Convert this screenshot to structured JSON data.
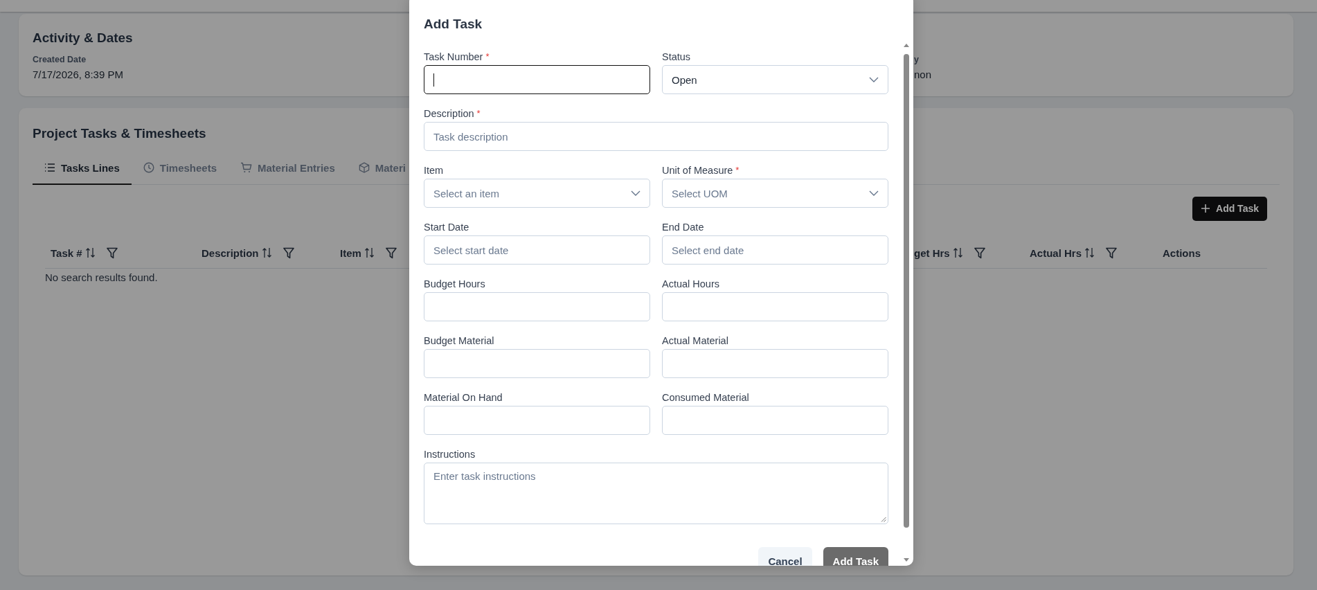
{
  "activity": {
    "title": "Activity & Dates",
    "fields": [
      {
        "label": "Created Date",
        "value": "7/17/2026, 8:39 PM"
      },
      {
        "label": "y",
        "value": "non"
      }
    ]
  },
  "tasks_panel": {
    "title": "Project Tasks & Timesheets",
    "tabs": [
      {
        "label": "Tasks Lines",
        "selected": true
      },
      {
        "label": "Timesheets",
        "selected": false
      },
      {
        "label": "Material Entries",
        "selected": false
      },
      {
        "label": "Materi",
        "selected": false
      }
    ],
    "add_button": "Add Task",
    "columns": [
      {
        "label": "Task #",
        "sortable": true,
        "filterable": true
      },
      {
        "label": "Description",
        "sortable": true,
        "filterable": true
      },
      {
        "label": "Item",
        "sortable": true,
        "filterable": true
      },
      {
        "label": "get Hrs",
        "sortable": true,
        "filterable": true
      },
      {
        "label": "Actual Hrs",
        "sortable": true,
        "filterable": true
      },
      {
        "label": "Actions",
        "sortable": false,
        "filterable": false
      }
    ],
    "empty_message": "No search results found."
  },
  "dialog": {
    "title": "Add Task",
    "fields": [
      {
        "label": "Task Number",
        "required_mark": "*",
        "kind": "text",
        "focused": true
      },
      {
        "label": "Status",
        "kind": "select",
        "value": "Open"
      },
      {
        "label": "Description",
        "required_mark": "*",
        "kind": "text",
        "placeholder": "Task description",
        "full_width": true
      },
      {
        "label": "Item",
        "kind": "select",
        "placeholder": "Select an item"
      },
      {
        "label": "Unit of Measure",
        "required_mark": "*",
        "kind": "select",
        "placeholder": "Select UOM"
      },
      {
        "label": "Start Date",
        "kind": "text",
        "placeholder": "Select start date"
      },
      {
        "label": "End Date",
        "kind": "text",
        "placeholder": "Select end date"
      },
      {
        "label": "Budget Hours",
        "kind": "text"
      },
      {
        "label": "Actual Hours",
        "kind": "text"
      },
      {
        "label": "Budget Material",
        "kind": "text"
      },
      {
        "label": "Actual Material",
        "kind": "text"
      },
      {
        "label": "Material On Hand",
        "kind": "text"
      },
      {
        "label": "Consumed Material",
        "kind": "text"
      },
      {
        "label": "Instructions",
        "kind": "textarea",
        "placeholder": "Enter task instructions",
        "full_width": true
      }
    ],
    "buttons": [
      {
        "label": "Cancel",
        "kind": "secondary",
        "disabled": false
      },
      {
        "label": "Add Task",
        "kind": "primary",
        "disabled": true
      }
    ]
  }
}
